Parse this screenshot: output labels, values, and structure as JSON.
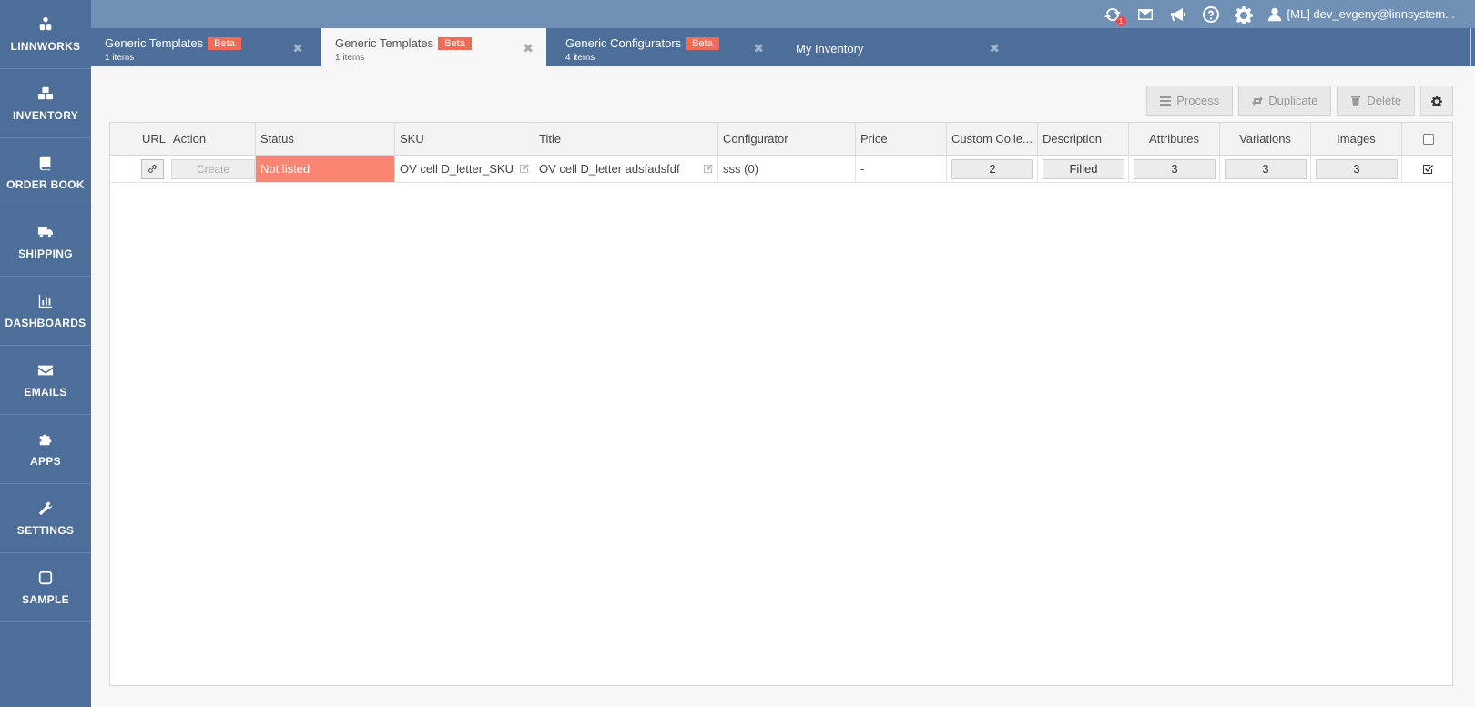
{
  "sidebar": {
    "items": [
      {
        "label": "LINNWORKS",
        "icon": "linnworks-logo-icon"
      },
      {
        "label": "INVENTORY",
        "icon": "inventory-icon"
      },
      {
        "label": "ORDER BOOK",
        "icon": "order-book-icon"
      },
      {
        "label": "SHIPPING",
        "icon": "truck-icon"
      },
      {
        "label": "DASHBOARDS",
        "icon": "bar-chart-icon"
      },
      {
        "label": "EMAILS",
        "icon": "envelope-icon"
      },
      {
        "label": "APPS",
        "icon": "puzzle-icon"
      },
      {
        "label": "SETTINGS",
        "icon": "wrench-icon"
      },
      {
        "label": "SAMPLE",
        "icon": "square-icon"
      }
    ]
  },
  "topbar": {
    "notification_count": "1",
    "user_label": "[ML] dev_evgeny@linnsystem..."
  },
  "tabs": [
    {
      "name": "Generic Templates",
      "badge": "Beta",
      "sub": "1 items",
      "active": false
    },
    {
      "name": "Generic Templates",
      "badge": "Beta",
      "sub": "1 items",
      "active": true
    },
    {
      "name": "Generic Configurators",
      "badge": "Beta",
      "sub": "4 items",
      "active": false
    },
    {
      "name": "My Inventory",
      "badge": "",
      "sub": "",
      "active": false
    }
  ],
  "toolbar": {
    "process_label": "Process",
    "duplicate_label": "Duplicate",
    "delete_label": "Delete"
  },
  "grid": {
    "columns": [
      "URL",
      "Action",
      "Status",
      "SKU",
      "Title",
      "Configurator",
      "Price",
      "Custom Colle...",
      "Description",
      "Attributes",
      "Variations",
      "Images"
    ],
    "rows": [
      {
        "action": "Create",
        "status": "Not listed",
        "sku": "OV cell D_letter_SKU",
        "title": "OV cell D_letter adsfadsfdf",
        "configurator": "sss (0)",
        "price": "-",
        "custom_collections": "2",
        "description": "Filled",
        "attributes": "3",
        "variations": "3",
        "images": "3",
        "selected": true
      }
    ]
  },
  "colors": {
    "sidebar_bg": "#4d6e98",
    "topbar_bg": "#7190b5",
    "badge": "#f26b57",
    "status_not_listed": "#fa8572"
  }
}
